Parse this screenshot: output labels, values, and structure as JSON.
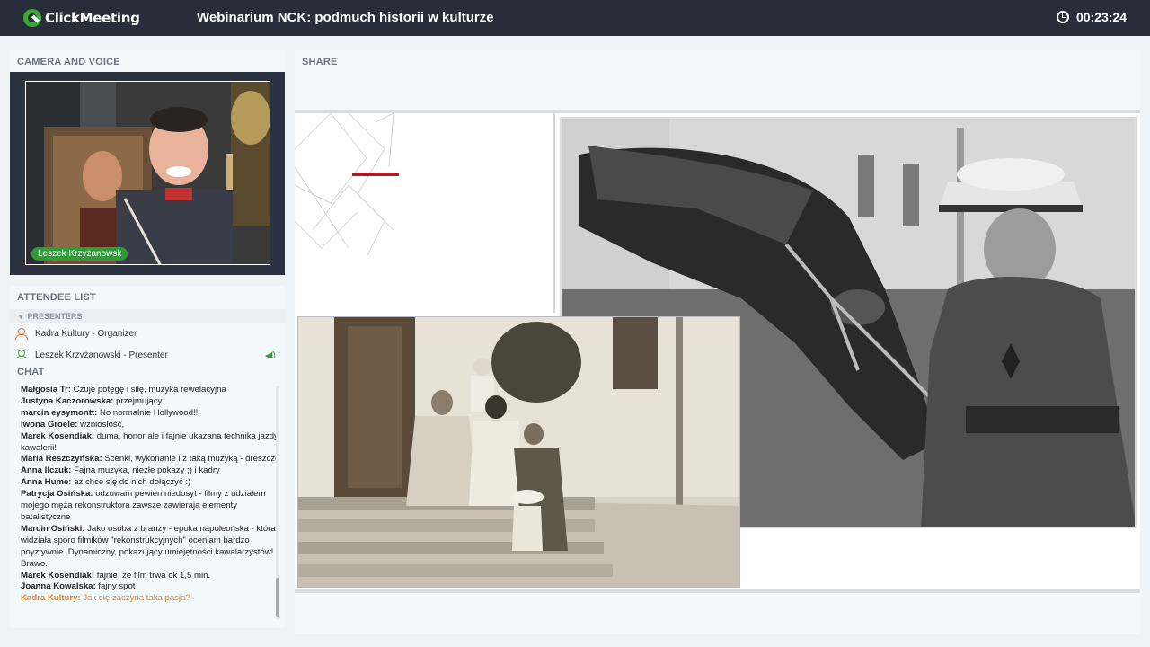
{
  "header": {
    "logo_text": "ClickMeeting",
    "title": "Webinarium NCK: podmuch historii w kulturze",
    "timer": "00:23:24"
  },
  "camera": {
    "heading": "CAMERA AND VOICE",
    "speaker_name": "Leszek Krzyżanowsk"
  },
  "attendees": {
    "heading": "ATTENDEE LIST",
    "group_label": "PRESENTERS",
    "items": [
      {
        "label": "Kadra Kultury  - Organizer"
      },
      {
        "label": "Leszek Krzyżanowski - Presenter"
      }
    ]
  },
  "chat": {
    "heading": "CHAT",
    "messages": [
      {
        "author": "Małgosia Tr:",
        "text": "Czuję potęgę i siłę, muzyka rewelacyjna"
      },
      {
        "author": "Justyna Kaczorowska:",
        "text": "przejmujący"
      },
      {
        "author": "marcin eysymontt:",
        "text": "No normalnie Hollywood!!!"
      },
      {
        "author": "Iwona  Groele:",
        "text": "wzniosłość,"
      },
      {
        "author": "Marek Kosendiak:",
        "text": "duma, honor ale i fajnie ukazana technika jazdy kawalerii!"
      },
      {
        "author": "Maria Reszczyńska:",
        "text": "Scenki, wykonanie i z taką muzyką - dreszcze"
      },
      {
        "author": "Anna Ilczuk:",
        "text": "Fajna muzyka, niezłe pokazy ;) i kadry"
      },
      {
        "author": "Anna Hume:",
        "text": "az chce się do nich dołączyć :)"
      },
      {
        "author": "Patrycja Osińska:",
        "text": "odzuwam pewien niedosyt - filmy z udziałem mojego męża rekonstruktora zawsze zawierają elementy batalistyczne"
      },
      {
        "author": "Marcin Osiński:",
        "text": "Jako osoba z branży - epoka napoleońska - która widziała sporo filmików \"rekonstrukcyjnych\" oceniam bardzo poyztywnie. Dynamiczny, pokazujący umiejętności kawalarzystów! Brawo."
      },
      {
        "author": "Marek Kosendiak:",
        "text": "fajnie, że film trwa ok 1,5 min."
      },
      {
        "author": "Joanna Kowalska:",
        "text": "fajny spot"
      },
      {
        "author": "Kadra Kultury:",
        "text": "Jak się zaczyna taka pasja?"
      }
    ]
  },
  "share": {
    "heading": "SHARE"
  },
  "colors": {
    "topbar": "#272e3a",
    "brand_green": "#3aaa35",
    "organizer_orange": "#d9822b",
    "accent_red": "#a81f22"
  }
}
